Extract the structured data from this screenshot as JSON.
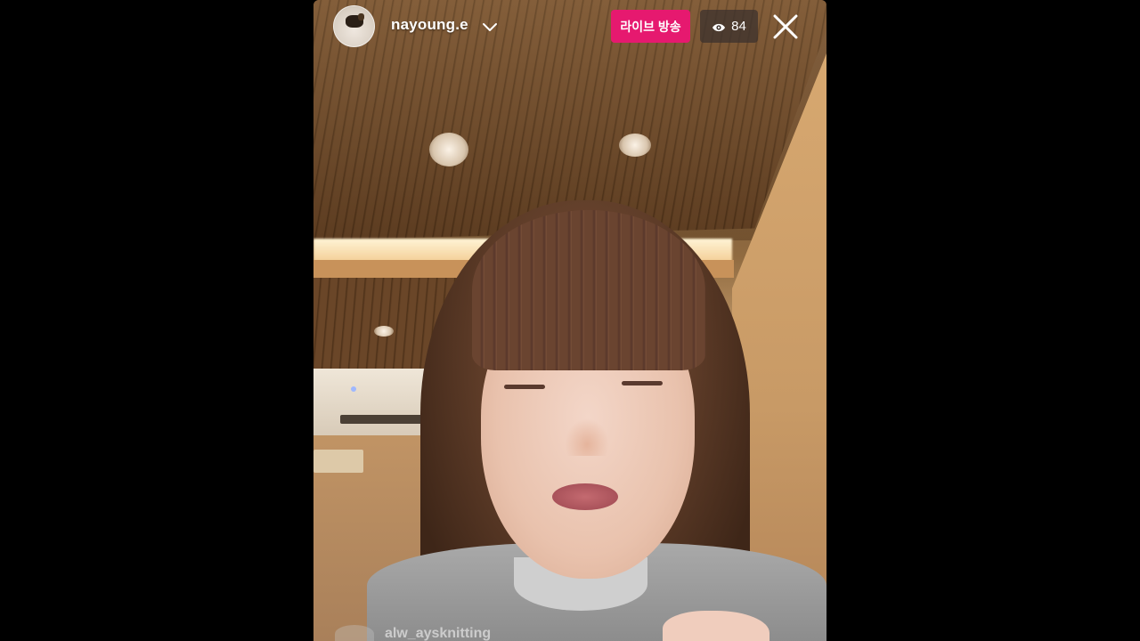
{
  "stream": {
    "username": "nayoung.e",
    "live_label": "라이브 방송",
    "viewer_count": "84"
  },
  "comments": [
    {
      "user": "alw_aysknitting"
    }
  ],
  "icons": {
    "dropdown": "chevron-down-icon",
    "viewers": "eye-icon",
    "close": "close-icon"
  },
  "colors": {
    "live_badge": "#e6196f",
    "viewer_badge": "#3c322d"
  }
}
